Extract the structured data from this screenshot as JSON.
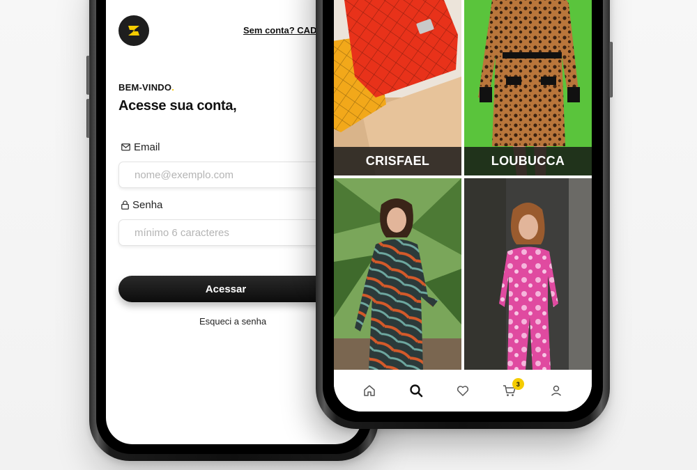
{
  "login": {
    "signup_link": "Sem conta? CADASTRE-SE",
    "welcome": "BEM-VINDO",
    "welcome_dot": ".",
    "heading": "Acesse sua conta,",
    "email_label": "Email",
    "email_placeholder": "nome@exemplo.com",
    "password_label": "Senha",
    "password_placeholder": "mínimo 6 caracteres",
    "submit_label": "Acessar",
    "forgot_label": "Esqueci a senha",
    "logo_icon": "z-logo-icon"
  },
  "catalog": {
    "brands": [
      {
        "name": "CRISFAEL"
      },
      {
        "name": "LOUBUCCA"
      }
    ]
  },
  "tabbar": {
    "items": [
      {
        "icon": "home-icon",
        "selected": false
      },
      {
        "icon": "search-icon",
        "selected": true
      },
      {
        "icon": "heart-icon",
        "selected": false
      },
      {
        "icon": "cart-icon",
        "selected": false
      },
      {
        "icon": "user-icon",
        "selected": false
      }
    ],
    "cart_badge": "3"
  },
  "colors": {
    "accent": "#f5cc00",
    "button": "#111111"
  }
}
